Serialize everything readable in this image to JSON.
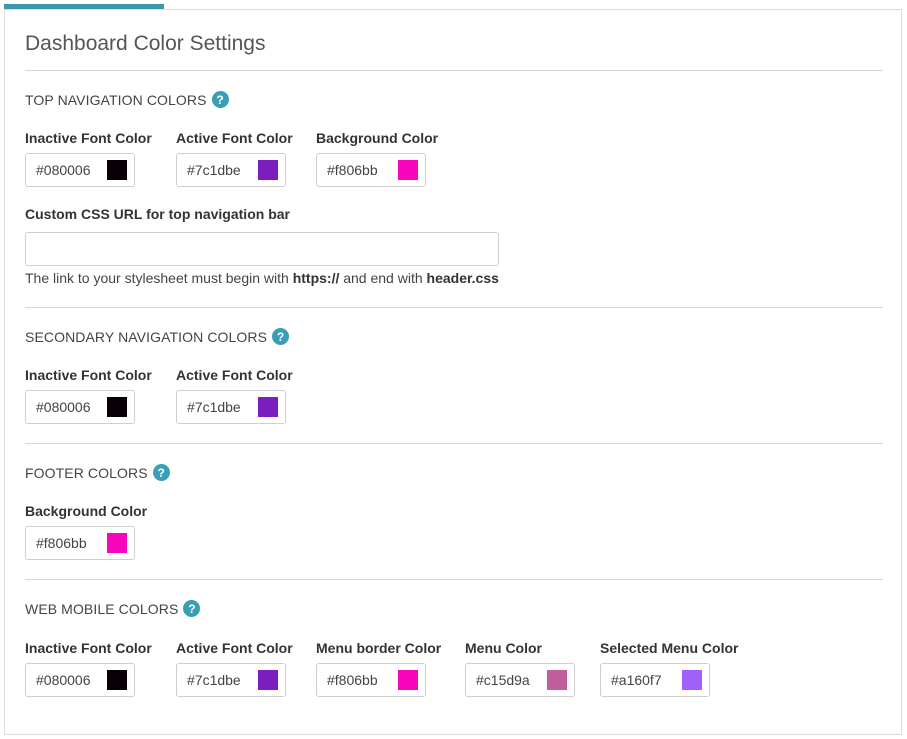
{
  "page": {
    "title": "Dashboard Color Settings"
  },
  "top_nav": {
    "title": "TOP NAVIGATION COLORS",
    "inactive": {
      "label": "Inactive Font Color",
      "value": "#080006",
      "swatch": "#080006"
    },
    "active": {
      "label": "Active Font Color",
      "value": "#7c1dbe",
      "swatch": "#7c1dbe"
    },
    "background": {
      "label": "Background Color",
      "value": "#f806bb",
      "swatch": "#f806bb"
    },
    "css_url": {
      "label": "Custom CSS URL for top navigation bar",
      "value": "",
      "hint_prefix": "The link to your stylesheet must begin with ",
      "hint_https": "https://",
      "hint_middle": " and end with ",
      "hint_file": "header.css"
    }
  },
  "secondary_nav": {
    "title": "SECONDARY NAVIGATION COLORS",
    "inactive": {
      "label": "Inactive Font Color",
      "value": "#080006",
      "swatch": "#080006"
    },
    "active": {
      "label": "Active Font Color",
      "value": "#7c1dbe",
      "swatch": "#7c1dbe"
    }
  },
  "footer": {
    "title": "FOOTER COLORS",
    "background": {
      "label": "Background Color",
      "value": "#f806bb",
      "swatch": "#f806bb"
    }
  },
  "web_mobile": {
    "title": "WEB MOBILE COLORS",
    "inactive": {
      "label": "Inactive Font Color",
      "value": "#080006",
      "swatch": "#080006"
    },
    "active": {
      "label": "Active Font Color",
      "value": "#7c1dbe",
      "swatch": "#7c1dbe"
    },
    "menu_border": {
      "label": "Menu border Color",
      "value": "#f806bb",
      "swatch": "#f806bb"
    },
    "menu": {
      "label": "Menu Color",
      "value": "#c15d9a",
      "swatch": "#c15d9a"
    },
    "selected_menu": {
      "label": "Selected Menu Color",
      "value": "#a160f7",
      "swatch": "#a160f7"
    }
  },
  "help_icon_glyph": "?",
  "accent_color": "#3a97ad"
}
